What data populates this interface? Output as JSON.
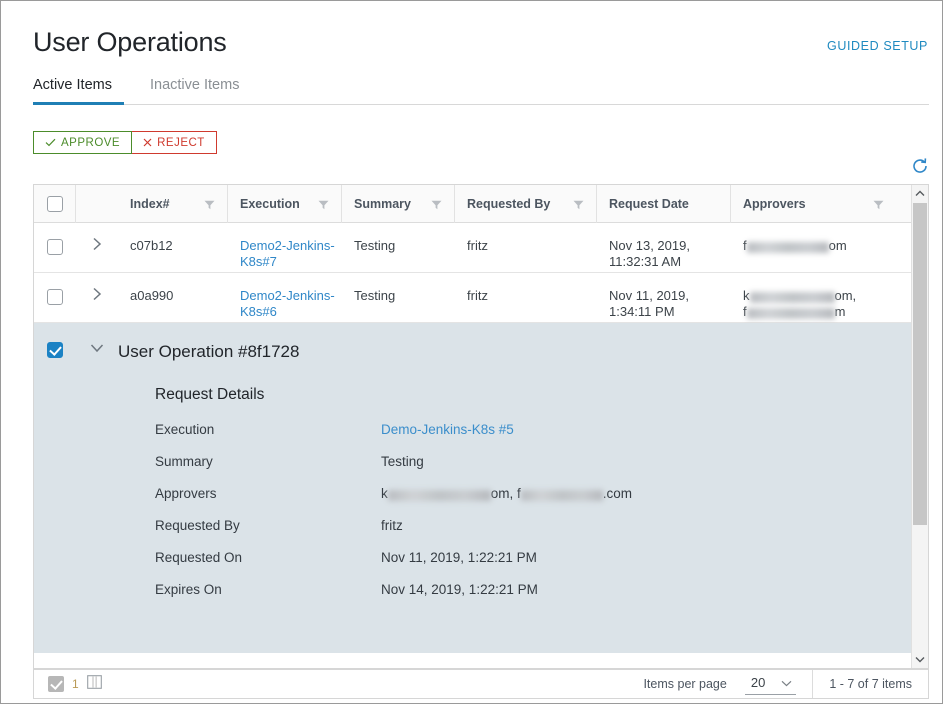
{
  "header": {
    "title": "User Operations",
    "guided_setup_label": "GUIDED SETUP"
  },
  "tabs": [
    {
      "label": "Active Items",
      "active": true
    },
    {
      "label": "Inactive Items",
      "active": false
    }
  ],
  "toolbar": {
    "approve_label": "APPROVE",
    "reject_label": "REJECT",
    "refresh_icon": "refresh-icon"
  },
  "table": {
    "columns": [
      {
        "label": "Index#",
        "filter": true
      },
      {
        "label": "Execution",
        "filter": true
      },
      {
        "label": "Summary",
        "filter": true
      },
      {
        "label": "Requested By",
        "filter": true
      },
      {
        "label": "Request Date",
        "filter": false
      },
      {
        "label": "Approvers",
        "filter": true
      }
    ],
    "rows": [
      {
        "index": "c07b12",
        "execution": "Demo2-Jenkins-K8s#7",
        "summary": "Testing",
        "requested_by": "fritz",
        "request_date_line1": "Nov 13, 2019,",
        "request_date_line2": "11:32:31 AM",
        "approver_prefix": "f",
        "approver_suffix": "om",
        "selected": false
      },
      {
        "index": "a0a990",
        "execution": "Demo2-Jenkins-K8s#6",
        "summary": "Testing",
        "requested_by": "fritz",
        "request_date_line1": "Nov 11, 2019,",
        "request_date_line2": "1:34:11 PM",
        "approver_prefix": "k",
        "approver_suffix": "om,",
        "approver2_prefix": "f",
        "approver2_suffix": "m",
        "selected": false
      }
    ]
  },
  "expanded_row": {
    "title": "User Operation #8f1728",
    "selected": true,
    "section_title": "Request Details",
    "fields": [
      {
        "label": "Execution",
        "value": "Demo-Jenkins-K8s #5",
        "link": true
      },
      {
        "label": "Summary",
        "value": "Testing",
        "link": false
      },
      {
        "label": "Approvers",
        "value": "",
        "link": false,
        "redacted": true,
        "redacted_prefix": "k",
        "redacted_mid": "om, f",
        "redacted_suffix": ".com"
      },
      {
        "label": "Requested By",
        "value": "fritz",
        "link": false
      },
      {
        "label": "Requested On",
        "value": "Nov 11, 2019, 1:22:21 PM",
        "link": false
      },
      {
        "label": "Expires On",
        "value": "Nov 14, 2019, 1:22:21 PM",
        "link": false
      }
    ]
  },
  "footer": {
    "selected_count": "1",
    "columns_icon": "columns-icon",
    "items_per_page_label": "Items per page",
    "items_per_page_value": "20",
    "range_label": "1 - 7 of 7 items"
  },
  "colors": {
    "accent_blue": "#1f7fb5",
    "link_blue": "#2f87c8",
    "approve_green": "#4c8c2b",
    "reject_red": "#cf3a2e",
    "expanded_bg": "#dbe3e8"
  }
}
